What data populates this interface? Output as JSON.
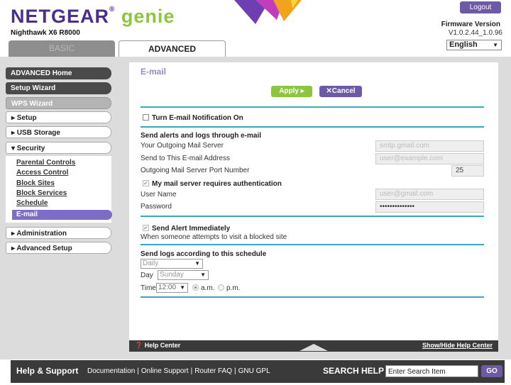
{
  "header": {
    "brand_part1": "NETGEAR",
    "brand_reg": "®",
    "brand_part2": " genie",
    "model": "Nighthawk X6 R8000",
    "logout_label": "Logout",
    "firmware_title": "Firmware Version",
    "firmware_version": "V1.0.2.44_1.0.96",
    "language": "English",
    "tabs": {
      "basic": "BASIC",
      "advanced": "ADVANCED"
    }
  },
  "sidebar": {
    "advanced_home": "ADVANCED Home",
    "setup_wizard": "Setup Wizard",
    "wps_wizard": "WPS Wizard",
    "setup": "▸ Setup",
    "usb_storage": "▸ USB Storage",
    "security": "▾ Security",
    "security_items": [
      "Parental Controls",
      "Access Control",
      "Block Sites",
      "Block Services",
      "Schedule"
    ],
    "active_item": "E-mail",
    "administration": "▸ Administration",
    "advanced_setup": "▸ Advanced Setup"
  },
  "main": {
    "title": "E-mail",
    "apply_label": "Apply ▸",
    "cancel_label": "✕Cancel",
    "turn_on_label": "Turn E-mail Notification On",
    "send_alerts_heading": "Send alerts and logs through e-mail",
    "outgoing_server_label": "Your Outgoing Mail Server",
    "outgoing_server_value": "smtp.gmail.com",
    "send_to_label": "Send to This E-mail Address",
    "send_to_value": "user@example.com",
    "port_label": "Outgoing Mail Server Port Number",
    "port_value": "25",
    "auth_label": "My mail server requires authentication",
    "username_label": "User Name",
    "username_value": "user@gmail.com",
    "password_label": "Password",
    "password_value": "••••••••••••••",
    "send_alert_label": "Send Alert Immediately",
    "send_alert_desc": "When someone attempts to visit a blocked site",
    "schedule_heading": "Send logs according to this schedule",
    "frequency_value": "Daily",
    "day_label": "Day",
    "day_value": "Sunday",
    "time_label": "Time",
    "time_value": "12:00",
    "am_label": "a.m.",
    "pm_label": "p.m."
  },
  "helpbar": {
    "help_center": "Help Center",
    "show_hide": "Show/Hide Help Center"
  },
  "footer": {
    "help_support": "Help & Support",
    "links": [
      "Documentation",
      "Online Support",
      "Router FAQ",
      "GNU GPL"
    ],
    "search_help_label": "SEARCH HELP",
    "search_placeholder": "Enter Search Item",
    "go_label": "GO"
  },
  "colors": {
    "brand_purple": "#4b2d8f",
    "brand_green": "#8cc63f",
    "accent_teal": "#3aa6b9",
    "button_purple": "#6e59a5"
  }
}
